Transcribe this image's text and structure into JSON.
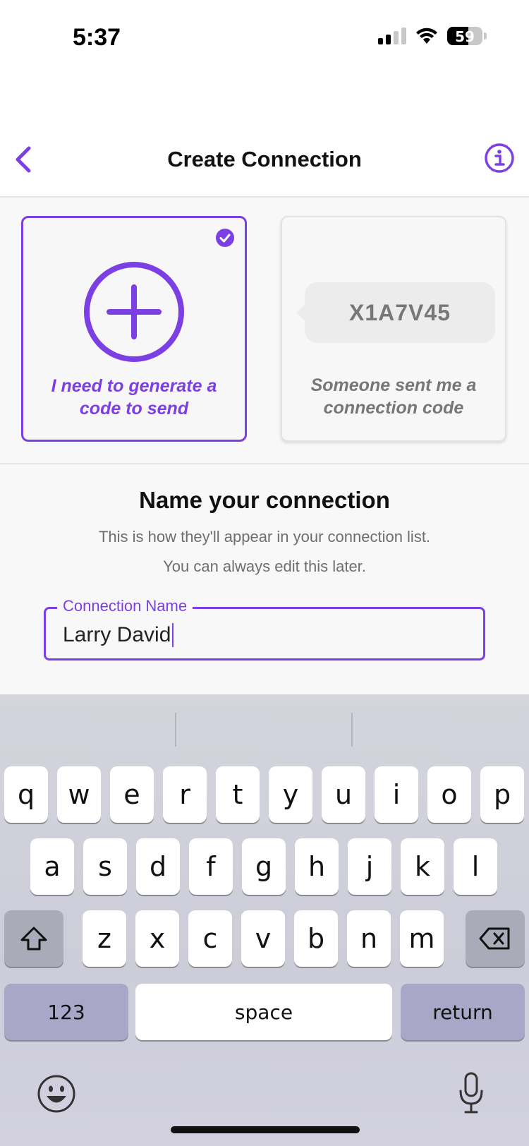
{
  "status_bar": {
    "time": "5:37",
    "battery": "59",
    "battery_level": 0.59
  },
  "header": {
    "title": "Create Connection",
    "back_icon": "chevron-left-icon",
    "info_icon": "info-icon"
  },
  "options": [
    {
      "label_line1": "I need to generate a",
      "label_line2": "code to send",
      "selected": true,
      "icon": "plus-circle-icon"
    },
    {
      "label_line1": "Someone sent me a",
      "label_line2": "connection code",
      "selected": false,
      "code": "X1A7V45"
    }
  ],
  "name_section": {
    "heading": "Name your connection",
    "subtitle_line1": "This is how they'll appear in your connection list.",
    "subtitle_line2": "You can always edit this later.",
    "field_label": "Connection Name",
    "field_value": "Larry David"
  },
  "keyboard": {
    "row1": [
      "q",
      "w",
      "e",
      "r",
      "t",
      "y",
      "u",
      "i",
      "o",
      "p"
    ],
    "row2": [
      "a",
      "s",
      "d",
      "f",
      "g",
      "h",
      "j",
      "k",
      "l"
    ],
    "row3": [
      "z",
      "x",
      "c",
      "v",
      "b",
      "n",
      "m"
    ],
    "numbers_label": "123",
    "space_label": "space",
    "return_label": "return"
  },
  "colors": {
    "accent": "#7b3fe4"
  }
}
